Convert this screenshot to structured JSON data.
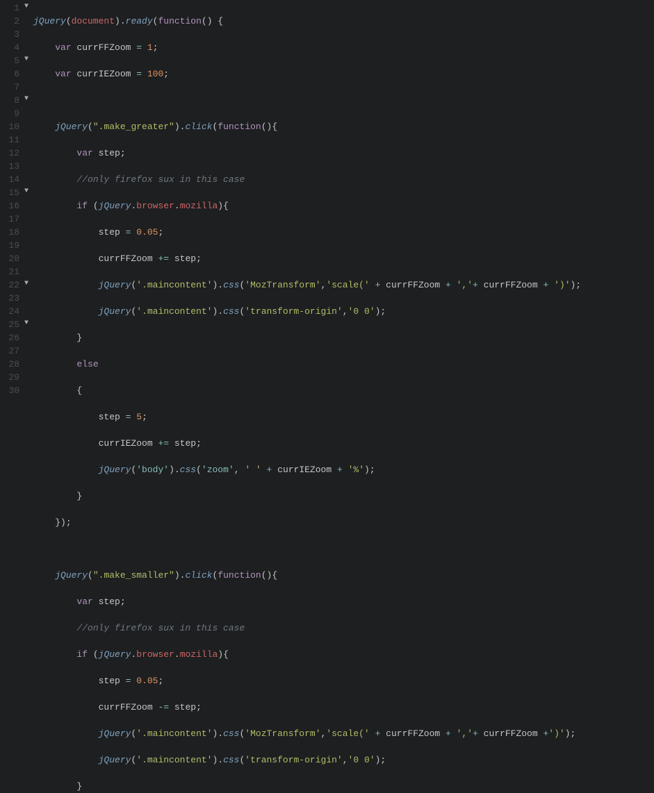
{
  "editor": {
    "lineNumbers": [
      "1",
      "2",
      "3",
      "4",
      "5",
      "6",
      "7",
      "8",
      "9",
      "10",
      "11",
      "12",
      "13",
      "14",
      "15",
      "16",
      "17",
      "18",
      "19",
      "20",
      "21",
      "22",
      "23",
      "24",
      "25",
      "26",
      "27",
      "28",
      "29",
      "30"
    ],
    "foldLines": [
      1,
      5,
      8,
      15,
      22,
      25
    ],
    "code": {
      "l1": {
        "a": "jQuery",
        "b": "(",
        "c": "document",
        "d": ").",
        "e": "ready",
        "f": "(",
        "g": "function",
        "h": "() {"
      },
      "l2": {
        "a": "var",
        "b": " currFFZoom ",
        "c": "=",
        "d": " ",
        "e": "1",
        "f": ";"
      },
      "l3": {
        "a": "var",
        "b": " currIEZoom ",
        "c": "=",
        "d": " ",
        "e": "100",
        "f": ";"
      },
      "l5": {
        "a": "jQuery",
        "b": "(",
        "c": "\".make_greater\"",
        "d": ").",
        "e": "click",
        "f": "(",
        "g": "function",
        "h": "(){"
      },
      "l6": {
        "a": "var",
        "b": " step;"
      },
      "l7": {
        "a": "//only firefox sux in this case"
      },
      "l8": {
        "a": "if",
        "b": " (",
        "c": "jQuery",
        "d": ".",
        "e": "browser",
        "f": ".",
        "g": "mozilla",
        "h": "){"
      },
      "l9": {
        "a": "step ",
        "b": "=",
        "c": " ",
        "d": "0.05",
        "e": ";"
      },
      "l10": {
        "a": "currFFZoom ",
        "b": "+=",
        "c": " step;"
      },
      "l11": {
        "a": "jQuery",
        "b": "(",
        "c": "'.maincontent'",
        "d": ").",
        "e": "css",
        "f": "(",
        "g": "'MozTransform'",
        "h": ",",
        "i": "'scale('",
        "j": " ",
        "k": "+",
        "l": " currFFZoom ",
        "m": "+",
        "n": " ",
        "o": "','",
        "p": "+",
        "q": " currFFZoom ",
        "r": "+",
        "s": " ",
        "t": "')'",
        "u": ");"
      },
      "l12": {
        "a": "jQuery",
        "b": "(",
        "c": "'.maincontent'",
        "d": ").",
        "e": "css",
        "f": "(",
        "g": "'transform-origin'",
        "h": ",",
        "i": "'0 0'",
        "j": ");"
      },
      "l13": {
        "a": "}"
      },
      "l14": {
        "a": "else"
      },
      "l15": {
        "a": "{"
      },
      "l16": {
        "a": "step ",
        "b": "=",
        "c": " ",
        "d": "5",
        "e": ";"
      },
      "l17": {
        "a": "currIEZoom ",
        "b": "+=",
        "c": " step;"
      },
      "l18": {
        "a": "jQuery",
        "b": "(",
        "c": "'body'",
        "d": ").",
        "e": "css",
        "f": "(",
        "g": "'zoom'",
        "h": ", ",
        "i": "' '",
        "j": " ",
        "k": "+",
        "l": " currIEZoom ",
        "m": "+",
        "n": " ",
        "o": "'%'",
        "p": ");"
      },
      "l19": {
        "a": "}"
      },
      "l20": {
        "a": "});"
      },
      "l22": {
        "a": "jQuery",
        "b": "(",
        "c": "\".make_smaller\"",
        "d": ").",
        "e": "click",
        "f": "(",
        "g": "function",
        "h": "(){"
      },
      "l23": {
        "a": "var",
        "b": " step;"
      },
      "l24": {
        "a": "//only firefox sux in this case"
      },
      "l25": {
        "a": "if",
        "b": " (",
        "c": "jQuery",
        "d": ".",
        "e": "browser",
        "f": ".",
        "g": "mozilla",
        "h": "){"
      },
      "l26": {
        "a": "step ",
        "b": "=",
        "c": " ",
        "d": "0.05",
        "e": ";"
      },
      "l27": {
        "a": "currFFZoom ",
        "b": "-=",
        "c": " step;"
      },
      "l28": {
        "a": "jQuery",
        "b": "(",
        "c": "'.maincontent'",
        "d": ").",
        "e": "css",
        "f": "(",
        "g": "'MozTransform'",
        "h": ",",
        "i": "'scale('",
        "j": " ",
        "k": "+",
        "l": " currFFZoom ",
        "m": "+",
        "n": " ",
        "o": "','",
        "p": "+",
        "q": " currFFZoom ",
        "r": "+",
        "s": "'",
        "t": ")'",
        "u": ");"
      },
      "l29": {
        "a": "jQuery",
        "b": "(",
        "c": "'.maincontent'",
        "d": ").",
        "e": "css",
        "f": "(",
        "g": "'transform-origin'",
        "h": ",",
        "i": "'0 0'",
        "j": ");"
      },
      "l30": {
        "a": "}"
      }
    }
  }
}
